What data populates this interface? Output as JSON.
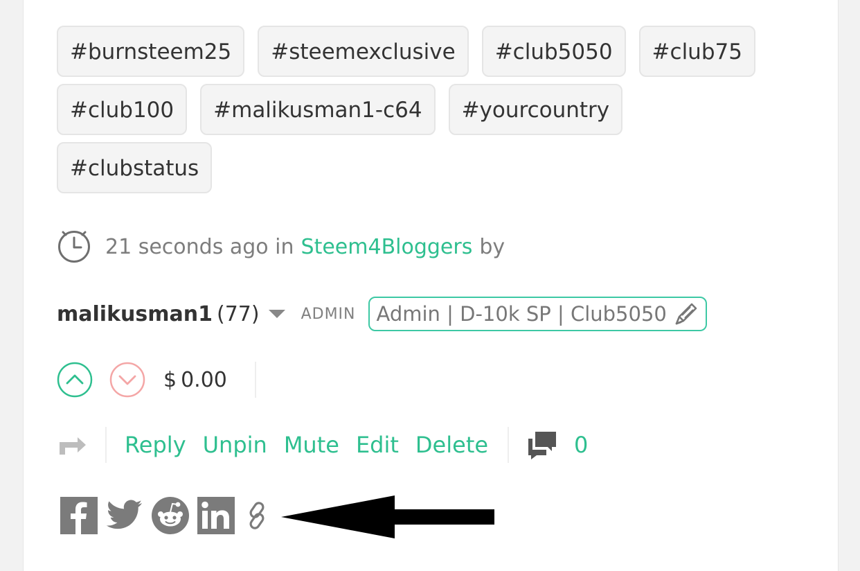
{
  "tags": [
    [
      "#burnsteem25",
      "#steemexclusive",
      "#club5050",
      "#club75"
    ],
    [
      "#club100",
      "#malikusman1-c64",
      "#yourcountry"
    ],
    [
      "#clubstatus"
    ]
  ],
  "meta": {
    "time": "21 seconds ago in",
    "community": "Steem4Bloggers",
    "by": "by"
  },
  "author": {
    "name": "malikusman1",
    "reputation": "(77)",
    "role": "ADMIN",
    "title": "Admin | D-10k SP | Club5050"
  },
  "votes": {
    "payout": "$ 0.00"
  },
  "actions": {
    "reply": "Reply",
    "unpin": "Unpin",
    "mute": "Mute",
    "edit": "Edit",
    "delete": "Delete",
    "comment_count": "0"
  },
  "icons": {
    "clock": "clock-icon",
    "caret": "chevron-down-icon",
    "pencil": "pencil-icon",
    "upvote": "upvote-icon",
    "downvote": "downvote-icon",
    "resteem": "resteem-icon",
    "comments": "comments-icon",
    "facebook": "facebook-icon",
    "twitter": "twitter-icon",
    "reddit": "reddit-icon",
    "linkedin": "linkedin-icon",
    "link": "link-icon",
    "arrow": "arrow-left-icon"
  },
  "colors": {
    "accent": "#2ebf8f",
    "badge_border": "#3dc8a4",
    "downvote": "#f4a6a6",
    "share_icon": "#7b7b7b"
  }
}
